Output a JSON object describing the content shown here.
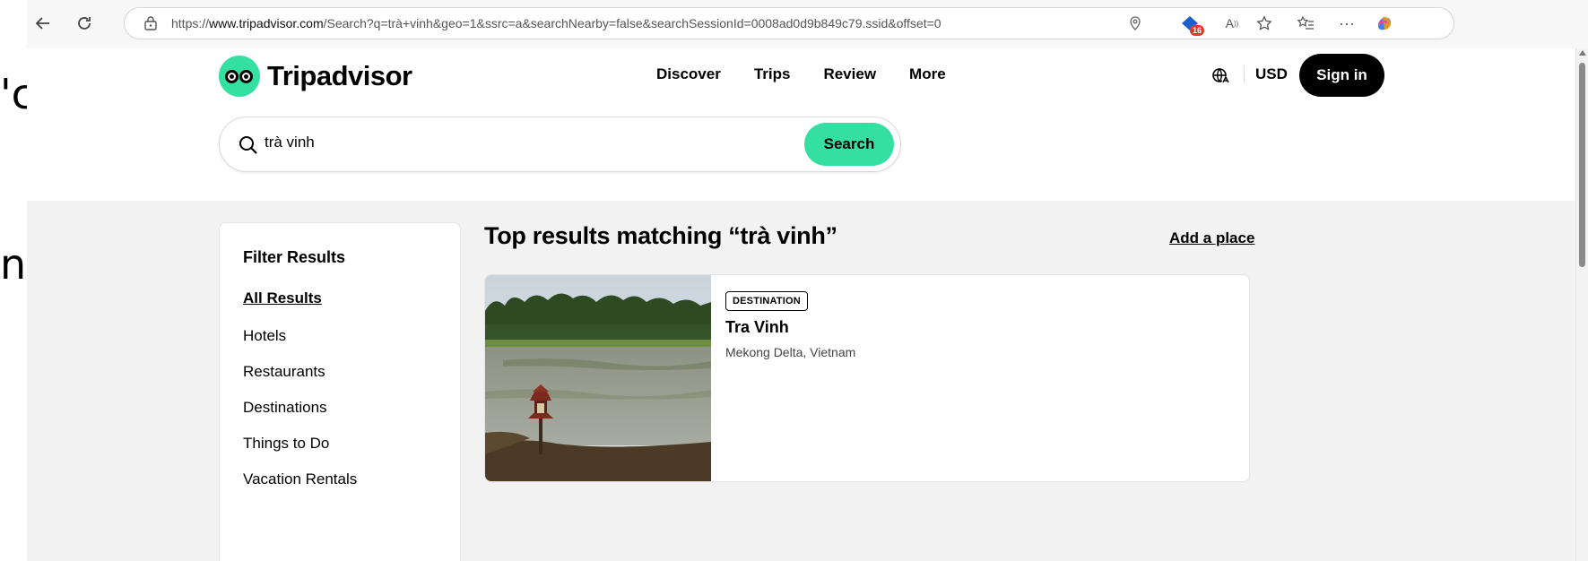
{
  "background_glyphs": [
    "'c",
    "ng"
  ],
  "browser": {
    "url_prefix": "https://",
    "url_host": "www.tripadvisor.com",
    "url_path": "/Search?q=trà+vinh&geo=1&ssrc=a&searchNearby=false&searchSessionId=0008ad0d9b849c79.ssid&offset=0",
    "extension_badge": "16"
  },
  "header": {
    "logo_text": "Tripadvisor",
    "nav": [
      "Discover",
      "Trips",
      "Review",
      "More"
    ],
    "currency": "USD",
    "sign_in": "Sign in"
  },
  "search": {
    "value": "trà vinh",
    "button": "Search"
  },
  "filters": {
    "title": "Filter Results",
    "items": [
      "All Results",
      "Hotels",
      "Restaurants",
      "Destinations",
      "Things to Do",
      "Vacation Rentals"
    ],
    "active": "All Results"
  },
  "results": {
    "title": "Top results matching “trà vinh”",
    "add_place": "Add a place",
    "items": [
      {
        "tag": "DESTINATION",
        "name": "Tra Vinh",
        "location": "Mekong Delta, Vietnam"
      }
    ]
  },
  "colors": {
    "brand_green": "#34e0a1",
    "page_bg": "#f2f2f2",
    "sign_in_bg": "#000000"
  }
}
